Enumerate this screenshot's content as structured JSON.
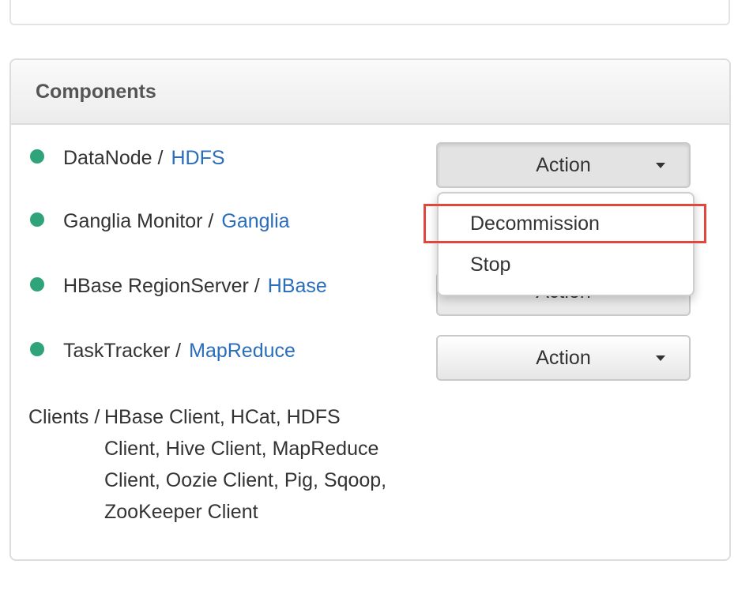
{
  "panel": {
    "title": "Components"
  },
  "components": [
    {
      "name": "DataNode",
      "sep": " /",
      "service": "HDFS",
      "status_color": "#2fa47b"
    },
    {
      "name": "Ganglia Monitor",
      "sep": " /",
      "service": "Ganglia",
      "status_color": "#2fa47b"
    },
    {
      "name": "HBase RegionServer",
      "sep": " /",
      "service": "HBase",
      "status_color": "#2fa47b"
    },
    {
      "name": "TaskTracker",
      "sep": " /",
      "service": "MapReduce",
      "status_color": "#2fa47b"
    }
  ],
  "action_label": "Action",
  "dropdown": {
    "items": [
      "Decommission",
      "Stop"
    ],
    "highlight_color": "#e2473f"
  },
  "clients": {
    "label": "Clients /",
    "list": "HBase Client, HCat, HDFS Client, Hive Client, MapReduce Client, Oozie Client, Pig, Sqoop, ZooKeeper Client"
  },
  "colors": {
    "link": "#2a6ebb",
    "status_ok": "#2fa47b"
  }
}
